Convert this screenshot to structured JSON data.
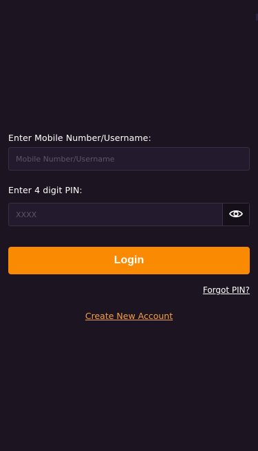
{
  "form": {
    "mobile_label": "Enter Mobile Number/Username:",
    "mobile_placeholder": "Mobile Number/Username",
    "mobile_value": "",
    "pin_label": "Enter 4 digit PIN:",
    "pin_placeholder": "XXXX",
    "pin_value": ""
  },
  "actions": {
    "login_label": "Login",
    "forgot_pin_label": "Forgot PIN?",
    "create_account_label": "Create New Account"
  },
  "icons": {
    "pin_visibility_toggle": "eye-icon"
  },
  "colors": {
    "background": "#1d1421",
    "field_background": "#241a2d",
    "accent": "#fb8a03",
    "link_accent": "#f3a04a"
  }
}
